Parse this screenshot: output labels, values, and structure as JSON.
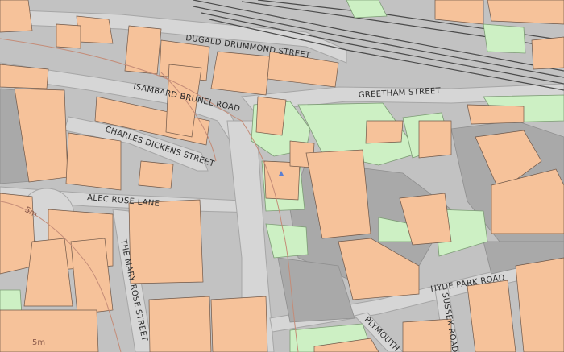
{
  "map": {
    "colors": {
      "ground": "#c2c2c2",
      "road": "#d6d6d6",
      "road_edge": "#a6a6a6",
      "building": "#f6c29a",
      "building_edge": "#6f5748",
      "paved": "#a9a9a9",
      "grass": "#cdf0c4",
      "grass_edge": "#7c9c74",
      "contour": "#c48c78",
      "rail": "#4a4a4a",
      "white": "#ffffff"
    },
    "labels": {
      "dugald_drummond_street": "DUGALD DRUMMOND STREET",
      "isambard_brunel_road": "ISAMBARD BRUNEL ROAD",
      "greetham_street": "GREETHAM STREET",
      "charles_dickens_street": "CHARLES DICKENS STREET",
      "alec_rose_lane": "ALEC ROSE LANE",
      "the_mary_rose_street": "THE MARY ROSE STREET",
      "hyde_park_road": "HYDE PARK ROAD",
      "plymouth_street": "PLYMOUTH",
      "sussex_street": "SUSSEX ROAD",
      "contour_5m_left": "5m",
      "contour_5m_bottom": "5m"
    }
  }
}
